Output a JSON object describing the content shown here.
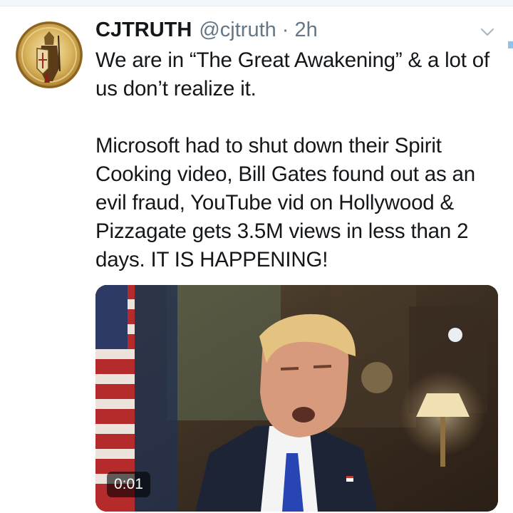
{
  "tweet": {
    "author_name": "CJTRUTH",
    "author_handle": "@cjtruth",
    "separator": "·",
    "timestamp": "2h",
    "paragraphs": [
      "We are in “The Great Awakening” & a lot of us don’t realize it.",
      "Microsoft had to shut down their Spirit Cooking video, Bill Gates found out as an evil fraud, YouTube vid on Hollywood & Pizzagate gets 3.5M views in less than 2 days. IT IS HAPPENING!"
    ],
    "media": {
      "type": "video",
      "duration": "0:01"
    }
  },
  "icons": {
    "menu": "chevron-down-icon",
    "avatar": "knight-emblem-avatar"
  },
  "colors": {
    "text": "#14171a",
    "secondary": "#657786",
    "background": "#ffffff"
  }
}
